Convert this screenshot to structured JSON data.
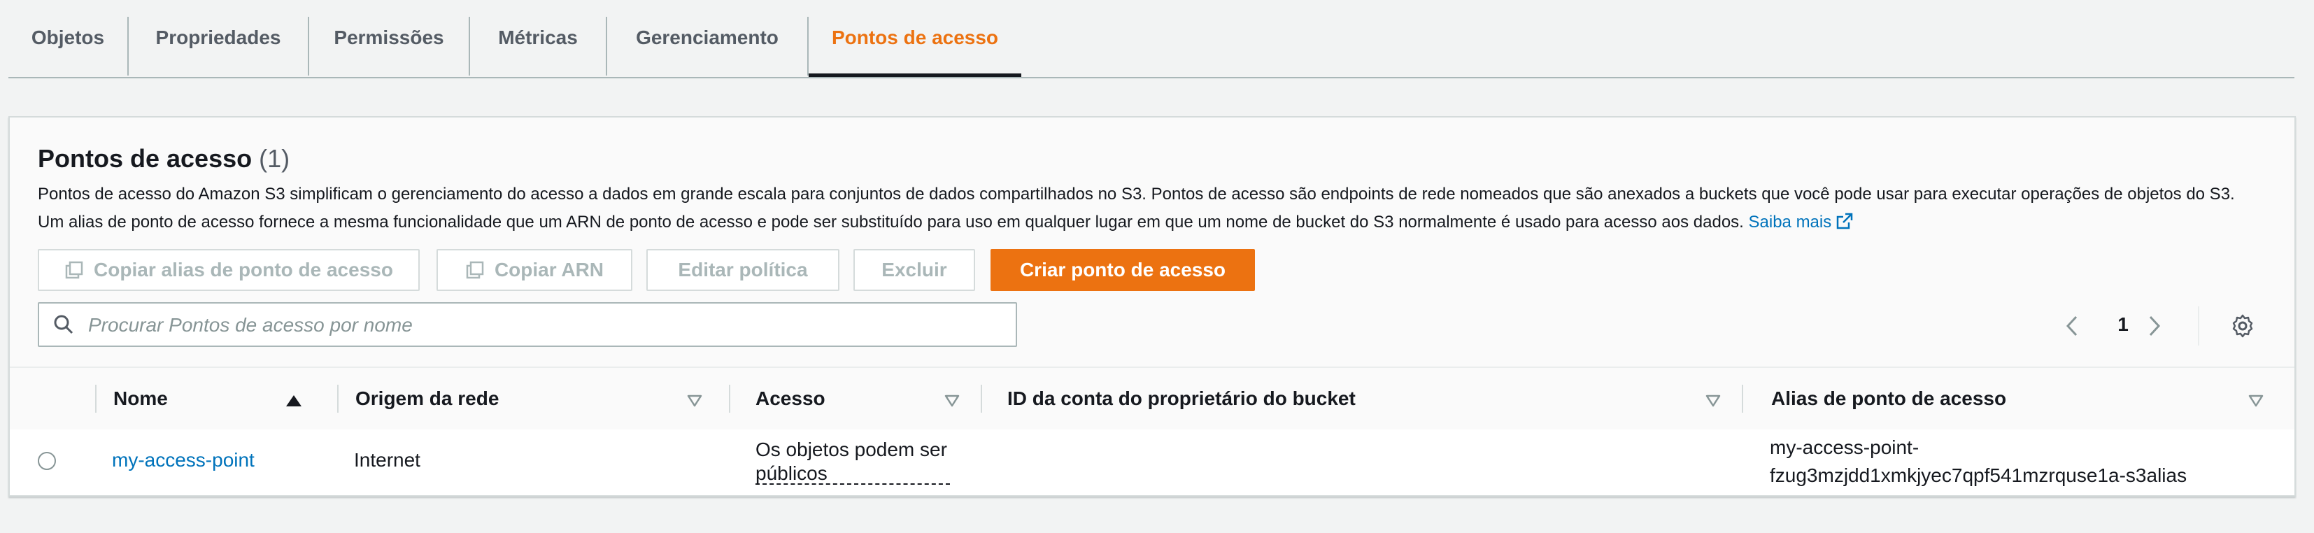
{
  "tabs": [
    {
      "label": "Objetos"
    },
    {
      "label": "Propriedades"
    },
    {
      "label": "Permissões"
    },
    {
      "label": "Métricas"
    },
    {
      "label": "Gerenciamento"
    },
    {
      "label": "Pontos de acesso",
      "active": true
    }
  ],
  "section": {
    "title": "Pontos de acesso",
    "count": "(1)",
    "description_line1": "Pontos de acesso do Amazon S3 simplificam o gerenciamento do acesso a dados em grande escala para conjuntos de dados compartilhados no S3. Pontos de acesso são endpoints de rede nomeados que são anexados a buckets que você pode usar para executar operações de objetos do S3.",
    "description_line2": "Um alias de ponto de acesso fornece a mesma funcionalidade que um ARN de ponto de acesso e pode ser substituído para uso em qualquer lugar em que um nome de bucket do S3 normalmente é usado para acesso aos dados.",
    "learn_more": "Saiba mais"
  },
  "actions": {
    "copy_alias": "Copiar alias de ponto de acesso",
    "copy_arn": "Copiar ARN",
    "edit_policy": "Editar política",
    "delete": "Excluir",
    "create": "Criar ponto de acesso"
  },
  "search": {
    "placeholder": "Procurar Pontos de acesso por nome",
    "value": ""
  },
  "pagination": {
    "current_page": "1"
  },
  "table": {
    "columns": [
      "Nome",
      "Origem da rede",
      "Acesso",
      "ID da conta do proprietário do bucket",
      "Alias de ponto de acesso"
    ],
    "rows": [
      {
        "name": "my-access-point",
        "network_origin": "Internet",
        "access_line1": "Os objetos podem ser",
        "access_line2": "públicos",
        "owner_account_id": "",
        "alias_line1": "my-access-point-",
        "alias_line2": "fzug3mzjdd1xmkjyec7qpf541mzrquse1a-s3alias"
      }
    ]
  },
  "colors": {
    "accent": "#ec7211",
    "link": "#0073bb",
    "disabled_text": "#aab7b8"
  }
}
